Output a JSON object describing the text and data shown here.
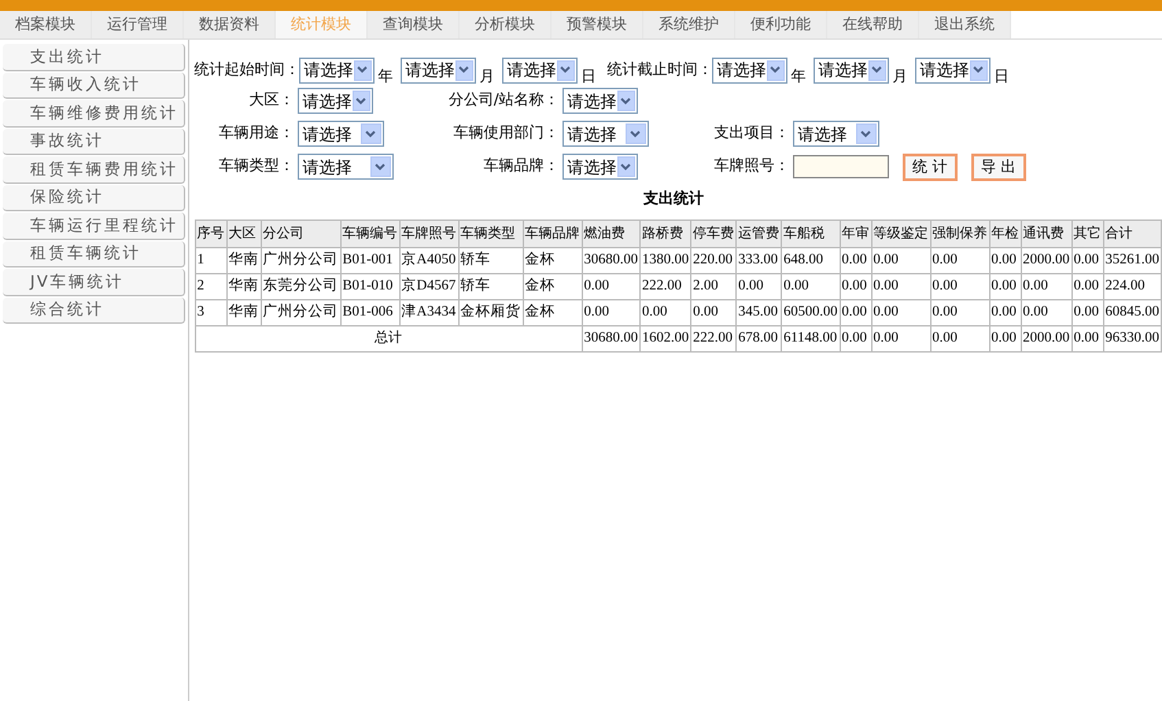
{
  "tabs": [
    {
      "label": "档案模块",
      "selected": false
    },
    {
      "label": "运行管理",
      "selected": false
    },
    {
      "label": "数据资料",
      "selected": false
    },
    {
      "label": "统计模块",
      "selected": true
    },
    {
      "label": "查询模块",
      "selected": false
    },
    {
      "label": "分析模块",
      "selected": false
    },
    {
      "label": "预警模块",
      "selected": false
    },
    {
      "label": "系统维护",
      "selected": false
    },
    {
      "label": "便利功能",
      "selected": false
    },
    {
      "label": "在线帮助",
      "selected": false
    },
    {
      "label": "退出系统",
      "selected": false
    }
  ],
  "sidebar": {
    "items": [
      {
        "label": "支出统计"
      },
      {
        "label": "车辆收入统计"
      },
      {
        "label": "车辆维修费用统计"
      },
      {
        "label": "事故统计"
      },
      {
        "label": "租赁车辆费用统计"
      },
      {
        "label": "保险统计"
      },
      {
        "label": "车辆运行里程统计"
      },
      {
        "label": "租赁车辆统计"
      },
      {
        "label": "JV车辆统计"
      },
      {
        "label": "综合统计"
      }
    ]
  },
  "date_filters": [
    {
      "label": "统计起始时间：",
      "parts": [
        {
          "value": "请选择",
          "unit": "年"
        },
        {
          "value": "请选择",
          "unit": "月"
        },
        {
          "value": "请选择",
          "unit": "日"
        }
      ]
    },
    {
      "label": "统计截止时间：",
      "parts": [
        {
          "value": "请选择",
          "unit": "年"
        },
        {
          "value": "请选择",
          "unit": "月"
        },
        {
          "value": "请选择",
          "unit": "日"
        }
      ]
    }
  ],
  "filter_rows": [
    [
      {
        "kind": "select",
        "label": "大区：",
        "value": "请选择"
      },
      {
        "kind": "select",
        "label": "分公司/站名称：",
        "value": "请选择"
      }
    ],
    [
      {
        "kind": "select",
        "label": "车辆用途：",
        "value": "请选择"
      },
      {
        "kind": "select",
        "label": "车辆使用部门：",
        "value": "请选择"
      },
      {
        "kind": "select",
        "label": "支出项目：",
        "value": "请选择"
      }
    ],
    [
      {
        "kind": "select",
        "label": "车辆类型：",
        "value": "请选择"
      },
      {
        "kind": "select",
        "label": "车辆品牌：",
        "value": "请选择"
      },
      {
        "kind": "text",
        "label": "车牌照号："
      }
    ]
  ],
  "buttons": [
    "统 计",
    "导 出"
  ],
  "table": {
    "title": "支出统计",
    "columns": [
      "序号",
      "大区",
      "分公司",
      "车辆编号",
      "车牌照号",
      "车辆类型",
      "车辆品牌",
      "燃油费",
      "路桥费",
      "停车费",
      "运管费",
      "车船税",
      "年审",
      "等级鉴定",
      "强制保养",
      "年检",
      "通讯费",
      "其它",
      "合计"
    ],
    "rows": [
      [
        "1",
        "华南",
        "广州分公司",
        "B01-001",
        "京A4050",
        "轿车",
        "金杯",
        "30680.00",
        "1380.00",
        "220.00",
        "333.00",
        "648.00",
        "0.00",
        "0.00",
        "0.00",
        "0.00",
        "2000.00",
        "0.00",
        "35261.00"
      ],
      [
        "2",
        "华南",
        "东莞分公司",
        "B01-010",
        "京D4567",
        "轿车",
        "金杯",
        "0.00",
        "222.00",
        "2.00",
        "0.00",
        "0.00",
        "0.00",
        "0.00",
        "0.00",
        "0.00",
        "0.00",
        "0.00",
        "224.00"
      ],
      [
        "3",
        "华南",
        "广州分公司",
        "B01-006",
        "津A3434",
        "金杯厢货",
        "金杯",
        "0.00",
        "0.00",
        "0.00",
        "345.00",
        "60500.00",
        "0.00",
        "0.00",
        "0.00",
        "0.00",
        "0.00",
        "0.00",
        "60845.00"
      ]
    ],
    "total": {
      "label": "总计",
      "values": [
        "30680.00",
        "1602.00",
        "222.00",
        "678.00",
        "61148.00",
        "0.00",
        "0.00",
        "0.00",
        "0.00",
        "2000.00",
        "0.00",
        "96330.00"
      ]
    }
  }
}
